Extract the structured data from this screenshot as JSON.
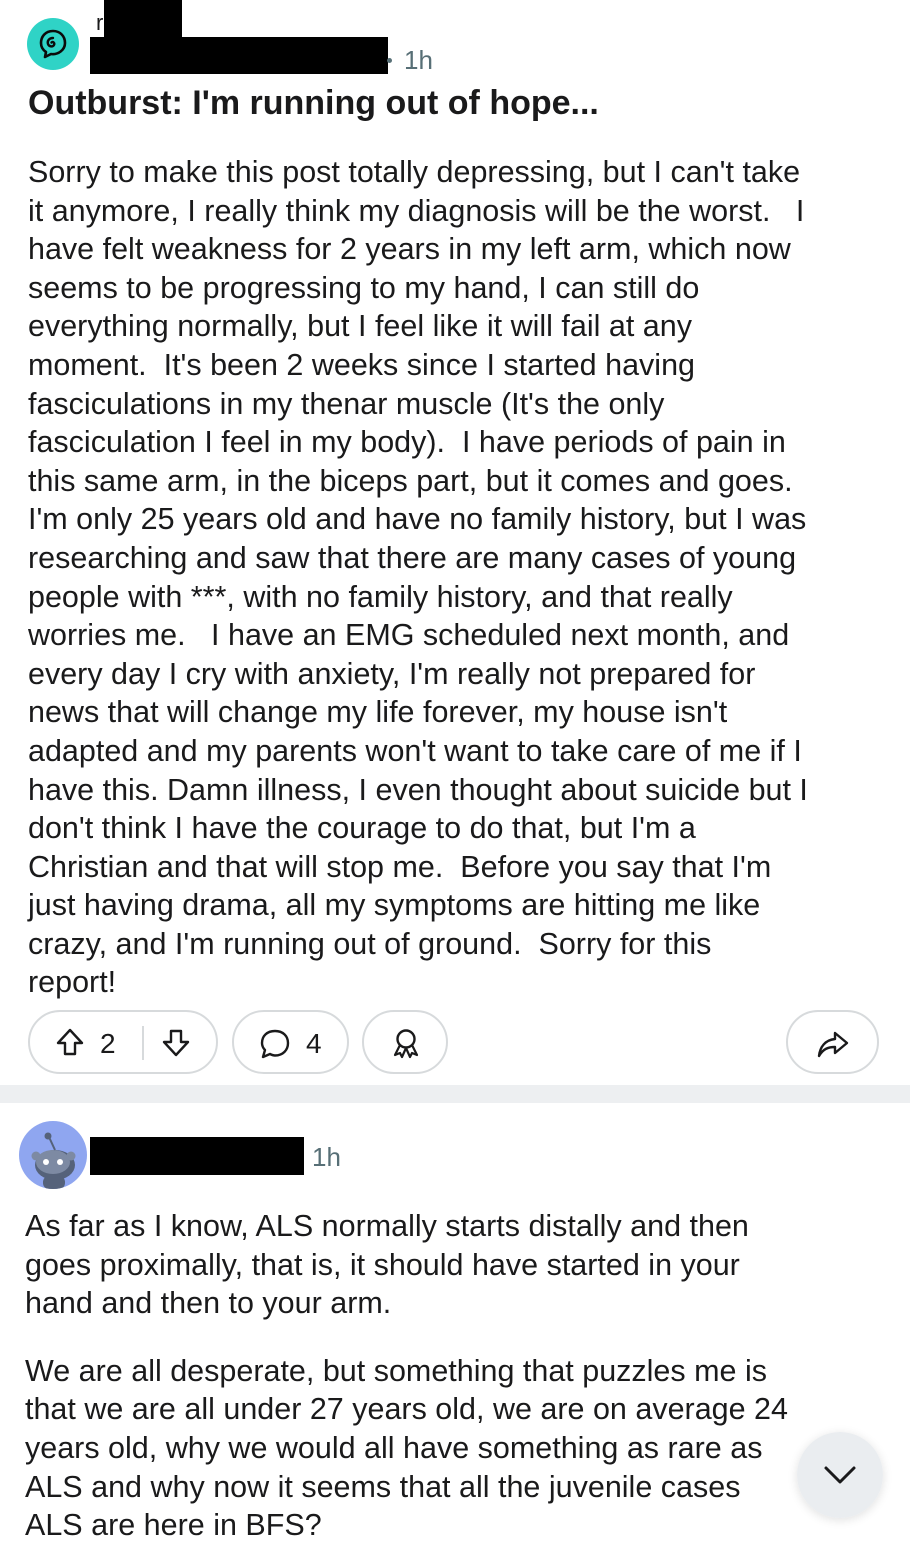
{
  "post": {
    "author_initial": "r",
    "time": "1h",
    "title": "Outburst: I'm running out of hope...",
    "body_lines": [
      "Sorry to make this post totally depressing, but I can't take",
      "it anymore, I really think my diagnosis will be the worst.   I",
      "have felt weakness for 2 years in my left arm, which now",
      "seems to be progressing to my hand, I can still do",
      "everything normally, but I feel like it will fail at any",
      "moment.  It's been 2 weeks since I started having",
      "fasciculations in my thenar muscle (It's the only",
      "fasciculation I feel in my body).  I have periods of pain in",
      "this same arm, in the biceps part, but it comes and goes.",
      "I'm only 25 years old and have no family history, but I was",
      "researching and saw that there are many cases of young",
      "people with ***, with no family history, and that really",
      "worries me.   I have an EMG scheduled next month, and",
      "every day I cry with anxiety, I'm really not prepared for",
      "news that will change my life forever, my house isn't",
      "adapted and my parents won't want to take care of me if I",
      "have this. Damn illness, I even thought about suicide but I",
      "don't think I have the courage to do that, but I'm a",
      "Christian and that will stop me.  Before you say that I'm",
      "just having drama, all my symptoms are hitting me like",
      "crazy, and I'm running out of ground.  Sorry for this",
      "report!"
    ],
    "actions": {
      "vote_count": "2",
      "comment_count": "4"
    }
  },
  "comment": {
    "time": "1h",
    "paragraph1_lines": [
      "As far as I know, ALS normally starts distally and then",
      "goes proximally, that is, it should have started in your",
      "hand and then to your arm."
    ],
    "paragraph2_lines": [
      "We are all desperate, but something that puzzles me is",
      "that we are all under 27 years old, we are on average 24",
      "years old, why we would all have something as rare as",
      "ALS and why now it seems that all the juvenile cases",
      "ALS are here in BFS?"
    ]
  },
  "colors": {
    "accent_teal": "#2fd3c6",
    "avatar_blue": "#8fa6f0",
    "border_gray": "#d7dadc",
    "meta_gray": "#576f76"
  },
  "icons": [
    "community-icon",
    "upvote-icon",
    "downvote-icon",
    "comment-icon",
    "award-icon",
    "share-icon",
    "snoo-avatar-icon",
    "chevron-down-icon"
  ]
}
